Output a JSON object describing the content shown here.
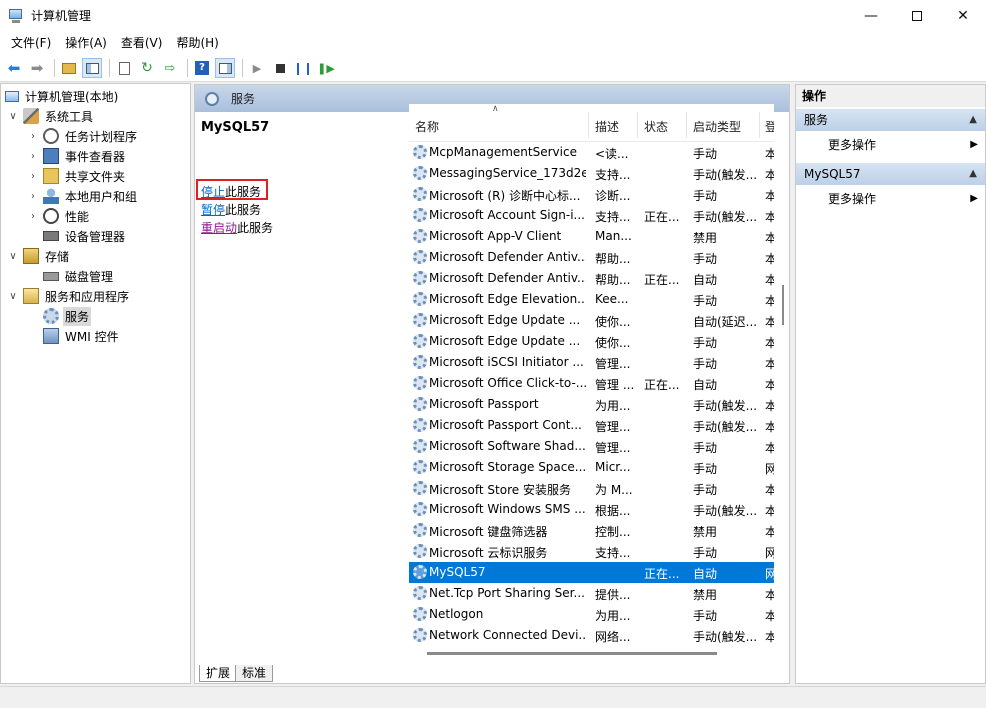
{
  "window": {
    "title": "计算机管理"
  },
  "menu": [
    "文件(F)",
    "操作(A)",
    "查看(V)",
    "帮助(H)"
  ],
  "tree": {
    "root": "计算机管理(本地)",
    "system_tools": "系统工具",
    "task_scheduler": "任务计划程序",
    "event_viewer": "事件查看器",
    "shared_folders": "共享文件夹",
    "local_users": "本地用户和组",
    "performance": "性能",
    "device_manager": "设备管理器",
    "storage": "存储",
    "disk_management": "磁盘管理",
    "services_apps": "服务和应用程序",
    "services": "服务",
    "wmi": "WMI 控件"
  },
  "center": {
    "header_title": "服务",
    "selected_service": "MySQL57",
    "actions": [
      {
        "link": "停止",
        "rest": "此服务"
      },
      {
        "link": "暂停",
        "rest": "此服务"
      },
      {
        "link": "重启动",
        "rest": "此服务"
      }
    ],
    "columns": [
      "名称",
      "描述",
      "状态",
      "启动类型",
      "登"
    ],
    "rows": [
      {
        "name": "McpManagementService",
        "desc": "<读...",
        "status": "",
        "startup": "手动",
        "logon": "本"
      },
      {
        "name": "MessagingService_173d2e",
        "desc": "支持...",
        "status": "",
        "startup": "手动(触发...",
        "logon": "本"
      },
      {
        "name": "Microsoft (R) 诊断中心标...",
        "desc": "诊断...",
        "status": "",
        "startup": "手动",
        "logon": "本"
      },
      {
        "name": "Microsoft Account Sign-i...",
        "desc": "支持...",
        "status": "正在...",
        "startup": "手动(触发...",
        "logon": "本"
      },
      {
        "name": "Microsoft App-V Client",
        "desc": "Man...",
        "status": "",
        "startup": "禁用",
        "logon": "本"
      },
      {
        "name": "Microsoft Defender Antiv...",
        "desc": "帮助...",
        "status": "",
        "startup": "手动",
        "logon": "本"
      },
      {
        "name": "Microsoft Defender Antiv...",
        "desc": "帮助...",
        "status": "正在...",
        "startup": "自动",
        "logon": "本"
      },
      {
        "name": "Microsoft Edge Elevation...",
        "desc": "Kee...",
        "status": "",
        "startup": "手动",
        "logon": "本"
      },
      {
        "name": "Microsoft Edge Update ...",
        "desc": "使你...",
        "status": "",
        "startup": "自动(延迟...",
        "logon": "本"
      },
      {
        "name": "Microsoft Edge Update ...",
        "desc": "使你...",
        "status": "",
        "startup": "手动",
        "logon": "本"
      },
      {
        "name": "Microsoft iSCSI Initiator ...",
        "desc": "管理...",
        "status": "",
        "startup": "手动",
        "logon": "本"
      },
      {
        "name": "Microsoft Office Click-to-...",
        "desc": "管理 ...",
        "status": "正在...",
        "startup": "自动",
        "logon": "本"
      },
      {
        "name": "Microsoft Passport",
        "desc": "为用...",
        "status": "",
        "startup": "手动(触发...",
        "logon": "本"
      },
      {
        "name": "Microsoft Passport Cont...",
        "desc": "管理...",
        "status": "",
        "startup": "手动(触发...",
        "logon": "本"
      },
      {
        "name": "Microsoft Software Shad...",
        "desc": "管理...",
        "status": "",
        "startup": "手动",
        "logon": "本"
      },
      {
        "name": "Microsoft Storage Space...",
        "desc": "Micr...",
        "status": "",
        "startup": "手动",
        "logon": "网"
      },
      {
        "name": "Microsoft Store 安装服务",
        "desc": "为 M...",
        "status": "",
        "startup": "手动",
        "logon": "本"
      },
      {
        "name": "Microsoft Windows SMS ...",
        "desc": "根据...",
        "status": "",
        "startup": "手动(触发...",
        "logon": "本"
      },
      {
        "name": "Microsoft 键盘筛选器",
        "desc": "控制...",
        "status": "",
        "startup": "禁用",
        "logon": "本"
      },
      {
        "name": "Microsoft 云标识服务",
        "desc": "支持...",
        "status": "",
        "startup": "手动",
        "logon": "网"
      },
      {
        "name": "MySQL57",
        "desc": "",
        "status": "正在...",
        "startup": "自动",
        "logon": "网",
        "selected": true
      },
      {
        "name": "Net.Tcp Port Sharing Ser...",
        "desc": "提供...",
        "status": "",
        "startup": "禁用",
        "logon": "本"
      },
      {
        "name": "Netlogon",
        "desc": "为用...",
        "status": "",
        "startup": "手动",
        "logon": "本"
      },
      {
        "name": "Network Connected Devi...",
        "desc": "网络...",
        "status": "",
        "startup": "手动(触发...",
        "logon": "本"
      }
    ],
    "tabs": [
      "扩展",
      "标准"
    ]
  },
  "actions_pane": {
    "title": "操作",
    "section1": "服务",
    "section1_more": "更多操作",
    "section2": "MySQL57",
    "section2_more": "更多操作"
  },
  "colors": {
    "selection": "#0078d7",
    "link": "#0066cc",
    "highlight_box": "#e02020"
  }
}
